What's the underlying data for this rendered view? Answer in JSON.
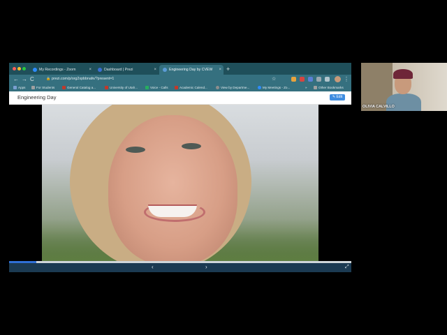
{
  "browser": {
    "tabs": [
      {
        "label": "My Recordings - Zoom",
        "close": "×",
        "icon": "zoom-favicon",
        "active": false
      },
      {
        "label": "Dashboard | Prezi",
        "close": "×",
        "icon": "prezi-favicon",
        "active": false
      },
      {
        "label": "Engineering Day by CVEW",
        "close": "×",
        "icon": "globe-favicon",
        "active": true
      }
    ],
    "new_tab": "+",
    "nav": {
      "back": "←",
      "forward": "→",
      "reload": "C"
    },
    "address": {
      "url": "prezi.com/p/org2xpbbnafe/?present=1",
      "lock": "🔒"
    },
    "star": "☆",
    "menu": "⋮",
    "bookmarks": [
      {
        "label": "Apps",
        "color": "#7a9fd0"
      },
      {
        "label": "For Students",
        "color": "#a0a0a0"
      },
      {
        "label": "General Catalog a...",
        "color": "#c0392b"
      },
      {
        "label": "University of Utah...",
        "color": "#c0392b"
      },
      {
        "label": "Voice - Calls",
        "color": "#27ae60"
      },
      {
        "label": "Academic Calend...",
        "color": "#c0392b"
      },
      {
        "label": "View by Departme...",
        "color": "#8e8e8e"
      },
      {
        "label": "My Meetings - Zo...",
        "color": "#2d8cff"
      },
      {
        "label": "Other Bookmarks",
        "color": "#a0a0a0"
      }
    ],
    "bookmarks_overflow": "»"
  },
  "prezi": {
    "title": "Engineering Day",
    "edit_label": "✎ Edit",
    "progress": 0.08,
    "prev": "‹",
    "next": "›",
    "fullscreen": "⤢"
  },
  "participant": {
    "name": "OLIVIA CALVILLO"
  },
  "colors": {
    "tab_strip": "#1f4f5a",
    "toolbar": "#35707f",
    "prezi_accent": "#3f8de0",
    "control_bar": "#1b3a52"
  }
}
